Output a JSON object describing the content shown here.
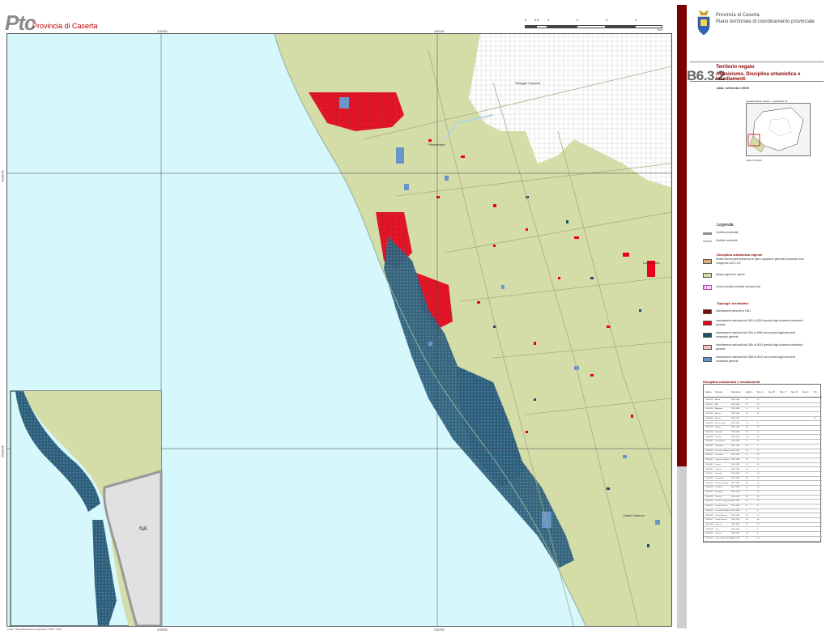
{
  "header": {
    "logo": "Ptc",
    "province_left": "Provincia di Caserta",
    "scale_ticks": [
      "0",
      "0,5",
      "1",
      "2",
      "3",
      "4"
    ],
    "scale_unit": "Km"
  },
  "panel": {
    "province": "Provincia di Caserta",
    "plan_name": "Piano territoriale di coordinamento provinciale",
    "code": "B6.3.2",
    "title_line1": "Territorio negato",
    "title_line2": "Abusivismo. Disciplina urbanistica e insediamenti",
    "date": "data: settembre 2009",
    "minimap_title": "Inquadramento tavola — quadrante 22",
    "scale": "scala 1:25.000"
  },
  "legend": {
    "title": "Legenda",
    "boundaries": [
      {
        "label": "Confine provinciale",
        "color": "#8c8c8c"
      },
      {
        "label": "Confine comunale",
        "color": "#bdbdbd"
      }
    ],
    "planning_title": "Disciplina urbanistica vigente",
    "planning": [
      {
        "label": "Sintesi idonea perimetrazione di piano regolatore generale comunale zone omogenee A,B,C,D,F",
        "color": "#f3d9b0",
        "style": "hatch"
      },
      {
        "label": "Spazio agricolo e aperto",
        "color": "#d4dca8",
        "style": "fill"
      },
      {
        "label": "Zone produttive previste dal piano Asi",
        "color": "#d070d0",
        "style": "grid"
      }
    ],
    "settlements_title": "Tipologie insediative",
    "settlements": [
      {
        "label": "Insediamenti presenti al 1961",
        "color": "#7a0a0a"
      },
      {
        "label": "Insediamenti realizzati dal 1961 al 1984 previsti dagli strumenti urbanistici generali",
        "color": "#e8001c"
      },
      {
        "label": "Insediamenti realizzati dal 1961 al 1984 non previsti dagli strumenti urbanistici generali",
        "color": "#1f4e68"
      },
      {
        "label": "Insediamenti realizzati dal 1984 al 2004 previsti dagli strumenti urbanistici generali",
        "color": "#f9c0c4"
      },
      {
        "label": "Insediamenti realizzati dal 1984 al 2004 non previsti dagli strumenti urbanistici generali",
        "color": "#6a95c8"
      }
    ]
  },
  "table": {
    "title": "Disciplina urbanistica e insediamenti",
    "headers": [
      "Codice",
      "Comune",
      "Strumento",
      "Approv.",
      "Sup. A",
      "Sup. B",
      "Sup. C",
      "Sup. D",
      "Sup. E",
      "Tot."
    ],
    "rows": [
      [
        "15061001",
        "Ailano",
        "PRG 1990",
        "41",
        "12",
        "",
        "",
        "",
        "",
        ""
      ],
      [
        "15061002",
        "Alife",
        "PRG 1983",
        "37",
        "33",
        "",
        "",
        "",
        "",
        ""
      ],
      [
        "15061003",
        "Alvignano",
        "PRG 1986",
        "79",
        "41",
        "",
        "",
        "",
        "",
        ""
      ],
      [
        "15061004",
        "Arienzo",
        "PRG 1985",
        "45",
        "62",
        "",
        "",
        "",
        "",
        ""
      ],
      [
        "15061005",
        "Aversa",
        "PRG 1978",
        "6",
        "",
        "",
        "",
        "",
        "",
        "30"
      ],
      [
        "15061006",
        "Baia e Latina",
        "PRG 1991",
        "15",
        "9",
        "",
        "",
        "",
        "",
        ""
      ],
      [
        "15061007",
        "Bellona",
        "PRG 1982",
        "50",
        "24",
        "",
        "",
        "",
        "",
        ""
      ],
      [
        "15061008",
        "Caianello",
        "PRG 1987",
        "48",
        "17",
        "",
        "",
        "",
        "",
        ""
      ],
      [
        "15061009",
        "Caiazzo",
        "PRG 1983",
        "30",
        "35",
        "",
        "",
        "",
        "",
        ""
      ],
      [
        "15061010",
        "Calvi Risorta",
        "PRG 1981",
        "4",
        "21",
        "",
        "",
        "",
        "",
        ""
      ],
      [
        "15061011",
        "Camigliano",
        "PRG 1996",
        "54",
        "1",
        "",
        "",
        "",
        "",
        ""
      ],
      [
        "15061012",
        "Cancello ed Arnone",
        "PRG 1987",
        "46",
        "17",
        "",
        "",
        "",
        "",
        ""
      ],
      [
        "15061013",
        "Capodrise",
        "PRG 1983",
        "6",
        "21",
        "",
        "",
        "",
        "",
        ""
      ],
      [
        "15061014",
        "Capriati a Volturno",
        "PRG 1999",
        "43",
        "19",
        "",
        "",
        "",
        "",
        ""
      ],
      [
        "15061015",
        "Capua",
        "PRG 1985",
        "15",
        "40",
        "",
        "",
        "",
        "",
        ""
      ],
      [
        "15061016",
        "Carinaro",
        "PRG 1994",
        "19",
        "2",
        "",
        "",
        "",
        "",
        ""
      ],
      [
        "15061017",
        "Carinola",
        "PRG 1983",
        "27",
        "28",
        "",
        "",
        "",
        "",
        ""
      ],
      [
        "15061018",
        "Casagiove",
        "PRG 1984",
        "36",
        "16",
        "",
        "",
        "",
        "",
        ""
      ],
      [
        "15061019",
        "Casal di Principe",
        "PRG 1990",
        "66",
        "20",
        "",
        "",
        "",
        "",
        ""
      ],
      [
        "15061020",
        "Casaluce",
        "PRG 1983",
        "20",
        "16",
        "",
        "",
        "",
        "",
        ""
      ],
      [
        "15061021",
        "Casapulla",
        "PRG 1993",
        "5",
        "25",
        "",
        "",
        "",
        "",
        ""
      ],
      [
        "15061022",
        "Caserta",
        "PRG 1987",
        "22",
        "49",
        "",
        "",
        "",
        "",
        ""
      ],
      [
        "15061023",
        "Castel Campagnano",
        "PRG 1993",
        "65",
        "10",
        "",
        "",
        "",
        "",
        ""
      ],
      [
        "15061024",
        "Castel di Sasso",
        "PRG 1995",
        "21",
        "9",
        "",
        "",
        "",
        "",
        ""
      ],
      [
        "15061025",
        "Castello del Matese",
        "PRG 1996",
        "8",
        "8",
        "",
        "",
        "",
        "",
        ""
      ],
      [
        "15061026",
        "Castel Morrone",
        "PRG 1980",
        "55",
        "12",
        "",
        "",
        "",
        "",
        ""
      ],
      [
        "15061027",
        "Castel Volturno",
        "PRG 1981",
        "89",
        "58",
        "",
        "",
        "",
        "",
        ""
      ],
      [
        "15061028",
        "Cervino",
        "PRG 1981",
        "57",
        "15",
        "",
        "",
        "",
        "",
        ""
      ],
      [
        "15061029",
        "Cesa",
        "PRG 1994",
        "4",
        "3",
        "",
        "",
        "",
        "",
        ""
      ],
      [
        "15061030",
        "Ciorlano",
        "PRG 1992",
        "19",
        "8",
        "",
        "",
        "",
        "",
        ""
      ],
      [
        "15061031",
        "Conca della Campania",
        "PRG 1983",
        "13",
        "19",
        "",
        "",
        "",
        "",
        ""
      ]
    ]
  },
  "map": {
    "place_labels": [
      "Villaggio Coppola",
      "Pinetamare",
      "Lago Patria",
      "Castel Volturno",
      "NA"
    ],
    "coords_top": [
      "4'25'00",
      "4'30'00"
    ],
    "coords_side": [
      "40'58'00",
      "40'55'00"
    ]
  },
  "footer": "Fonte: cartografia tecnica regionale 1:5.000 - 2004",
  "colors": {
    "sea": "#d6f7fb",
    "agri": "#d4dca8",
    "blue": "#1f4e68",
    "lightblue": "#6a95c8",
    "red": "#e8001c",
    "darkred": "#7a0a0a",
    "pink": "#f9c0c4"
  }
}
